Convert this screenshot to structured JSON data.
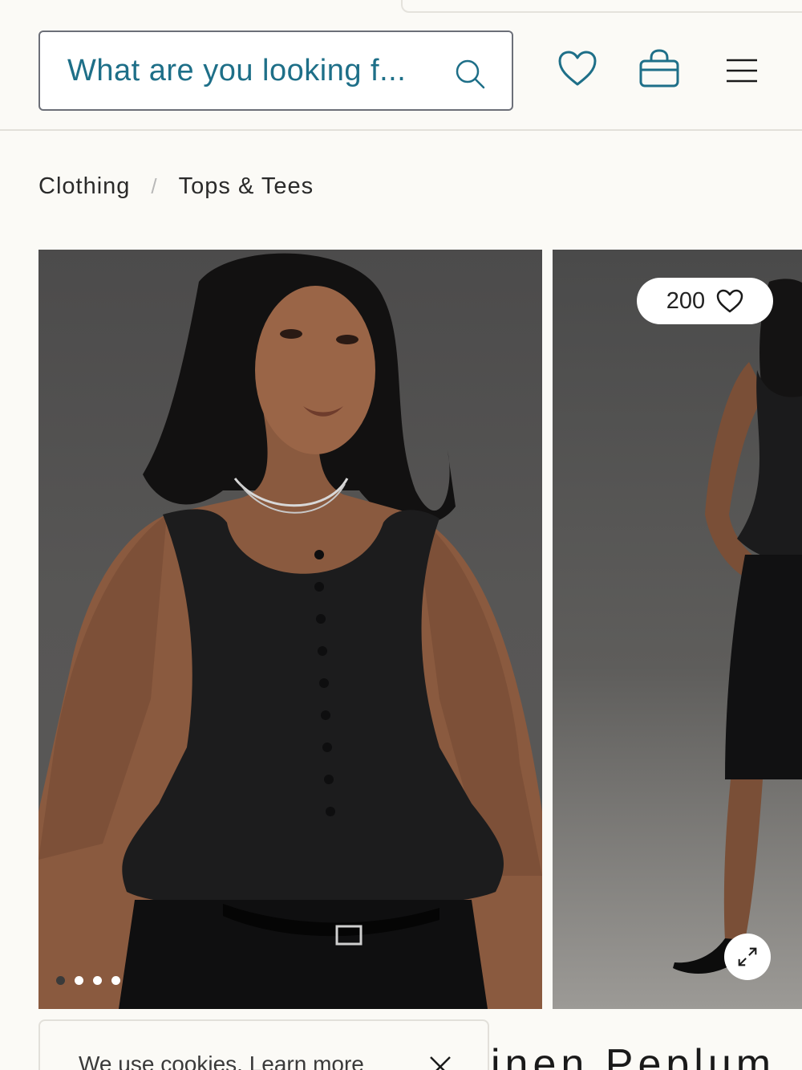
{
  "header": {
    "search": {
      "placeholder": "What are you looking f..."
    },
    "icons": [
      "search-icon",
      "heart-icon",
      "bag-icon",
      "hamburger-menu-icon"
    ]
  },
  "breadcrumb": {
    "items": [
      "Clothing",
      "Tops & Tees"
    ],
    "separator": "/"
  },
  "gallery": {
    "like_count": "200",
    "dots_count": 4,
    "active_dot_index": 0
  },
  "cookie_banner": {
    "text": "We use cookies. Learn more"
  },
  "product": {
    "title_partial": "inen Peplum"
  },
  "colors": {
    "accent": "#1e6f88",
    "background": "#fbfaf6"
  }
}
